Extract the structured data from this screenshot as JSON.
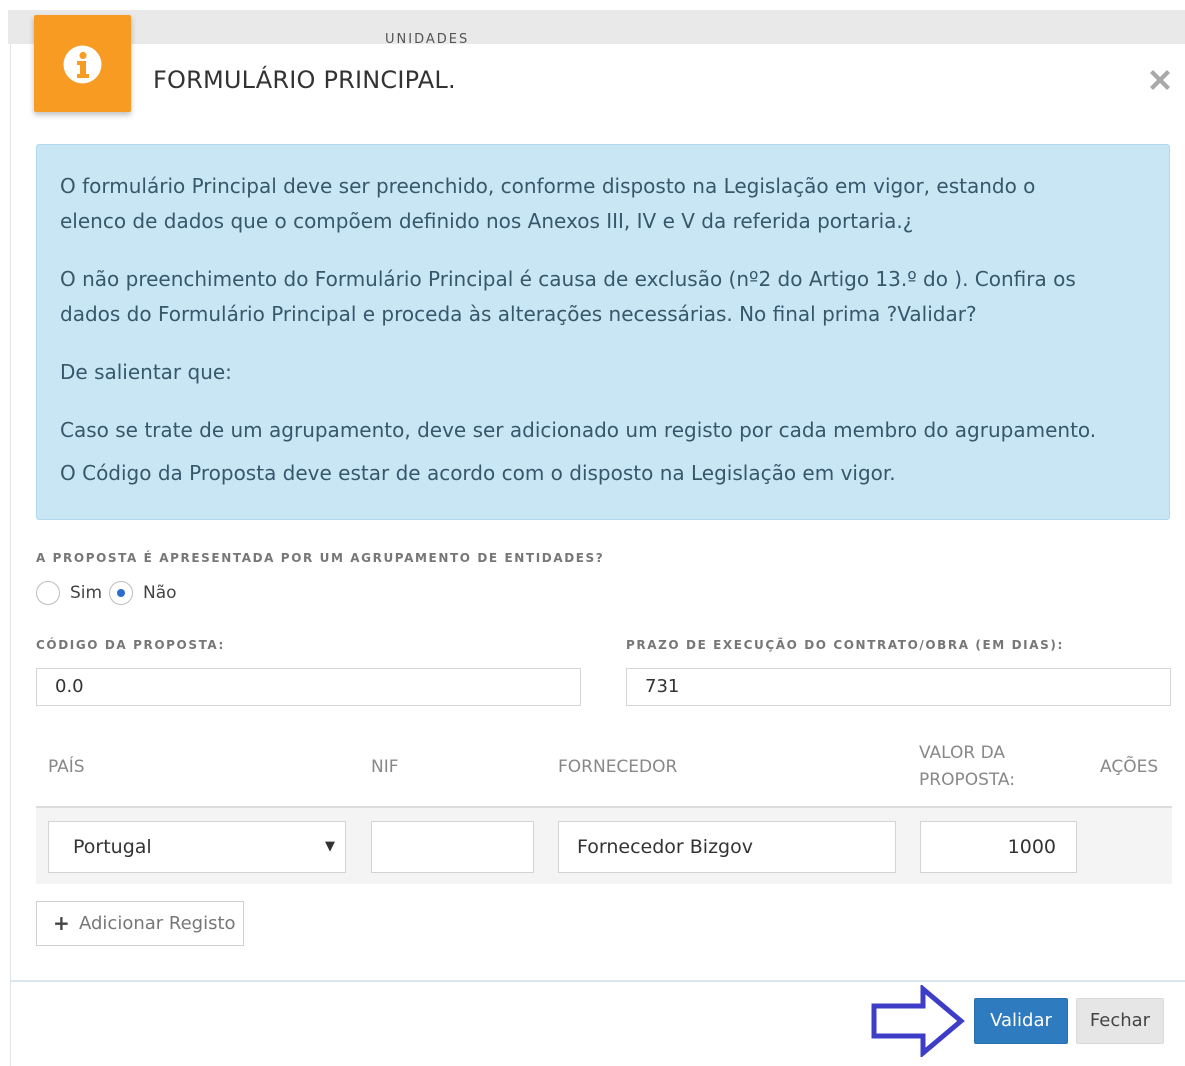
{
  "background": {
    "partial_text": "UNIDADES"
  },
  "modal": {
    "title": "FORMULÁRIO PRINCIPAL.",
    "icons": {
      "badge": "info-icon",
      "close": "close-icon"
    },
    "colors": {
      "badge": "#f89b22",
      "alert_bg": "#c9e6f4",
      "primary": "#2f7bbf"
    }
  },
  "alert": {
    "p1_line1": "O formulário Principal deve ser preenchido, conforme disposto na Legislação em vigor, estando o",
    "p1_line2": "elenco de dados que o compõem definido nos Anexos III, IV e V da referida portaria.¿",
    "p2_line1": "O não preenchimento do Formulário Principal é causa de exclusão (nº2 do Artigo 13.º do ). Confira os",
    "p2_line2": "dados do Formulário Principal e proceda às alterações necessárias. No final prima ?Validar?",
    "p3": "De salientar que:",
    "p4": "Caso se trate de um agrupamento, deve ser adicionado um registo por cada membro do agrupamento.",
    "p5": "O Código da Proposta deve estar de acordo com o disposto na Legislação em vigor."
  },
  "form": {
    "grouping_label": "A PROPOSTA É APRESENTADA POR UM AGRUPAMENTO DE ENTIDADES?",
    "grouping_options": [
      "Sim",
      "Não"
    ],
    "grouping_selected": "Não",
    "code_label": "CÓDIGO DA PROPOSTA:",
    "code_value": "0.0",
    "deadline_label": "PRAZO DE EXECUÇÃO DO CONTRATO/OBRA (EM DIAS):",
    "deadline_value": "731"
  },
  "table": {
    "headers": {
      "pais": "PAÍS",
      "nif": "NIF",
      "fornecedor": "FORNECEDOR",
      "valor_line1": "VALOR DA",
      "valor_line2": "PROPOSTA:",
      "acoes": "AÇÕES"
    },
    "rows": [
      {
        "pais": "Portugal",
        "nif": "",
        "fornecedor": "Fornecedor Bizgov",
        "valor": "1000"
      }
    ]
  },
  "buttons": {
    "add_record": "Adicionar Registo",
    "validate": "Validar",
    "close": "Fechar"
  },
  "annotation": {
    "arrow_color": "#3d3dc8"
  }
}
